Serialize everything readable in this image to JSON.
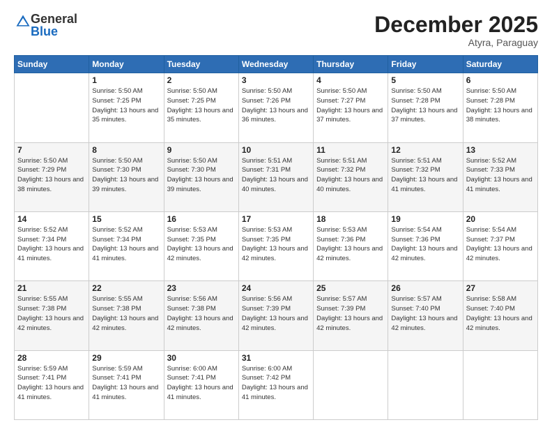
{
  "header": {
    "logo_general": "General",
    "logo_blue": "Blue",
    "month_title": "December 2025",
    "location": "Atyra, Paraguay"
  },
  "calendar": {
    "days_of_week": [
      "Sunday",
      "Monday",
      "Tuesday",
      "Wednesday",
      "Thursday",
      "Friday",
      "Saturday"
    ],
    "weeks": [
      [
        {
          "day": "",
          "info": ""
        },
        {
          "day": "1",
          "info": "Sunrise: 5:50 AM\nSunset: 7:25 PM\nDaylight: 13 hours\nand 35 minutes."
        },
        {
          "day": "2",
          "info": "Sunrise: 5:50 AM\nSunset: 7:25 PM\nDaylight: 13 hours\nand 35 minutes."
        },
        {
          "day": "3",
          "info": "Sunrise: 5:50 AM\nSunset: 7:26 PM\nDaylight: 13 hours\nand 36 minutes."
        },
        {
          "day": "4",
          "info": "Sunrise: 5:50 AM\nSunset: 7:27 PM\nDaylight: 13 hours\nand 37 minutes."
        },
        {
          "day": "5",
          "info": "Sunrise: 5:50 AM\nSunset: 7:28 PM\nDaylight: 13 hours\nand 37 minutes."
        },
        {
          "day": "6",
          "info": "Sunrise: 5:50 AM\nSunset: 7:28 PM\nDaylight: 13 hours\nand 38 minutes."
        }
      ],
      [
        {
          "day": "7",
          "info": "Sunrise: 5:50 AM\nSunset: 7:29 PM\nDaylight: 13 hours\nand 38 minutes."
        },
        {
          "day": "8",
          "info": "Sunrise: 5:50 AM\nSunset: 7:30 PM\nDaylight: 13 hours\nand 39 minutes."
        },
        {
          "day": "9",
          "info": "Sunrise: 5:50 AM\nSunset: 7:30 PM\nDaylight: 13 hours\nand 39 minutes."
        },
        {
          "day": "10",
          "info": "Sunrise: 5:51 AM\nSunset: 7:31 PM\nDaylight: 13 hours\nand 40 minutes."
        },
        {
          "day": "11",
          "info": "Sunrise: 5:51 AM\nSunset: 7:32 PM\nDaylight: 13 hours\nand 40 minutes."
        },
        {
          "day": "12",
          "info": "Sunrise: 5:51 AM\nSunset: 7:32 PM\nDaylight: 13 hours\nand 41 minutes."
        },
        {
          "day": "13",
          "info": "Sunrise: 5:52 AM\nSunset: 7:33 PM\nDaylight: 13 hours\nand 41 minutes."
        }
      ],
      [
        {
          "day": "14",
          "info": "Sunrise: 5:52 AM\nSunset: 7:34 PM\nDaylight: 13 hours\nand 41 minutes."
        },
        {
          "day": "15",
          "info": "Sunrise: 5:52 AM\nSunset: 7:34 PM\nDaylight: 13 hours\nand 41 minutes."
        },
        {
          "day": "16",
          "info": "Sunrise: 5:53 AM\nSunset: 7:35 PM\nDaylight: 13 hours\nand 42 minutes."
        },
        {
          "day": "17",
          "info": "Sunrise: 5:53 AM\nSunset: 7:35 PM\nDaylight: 13 hours\nand 42 minutes."
        },
        {
          "day": "18",
          "info": "Sunrise: 5:53 AM\nSunset: 7:36 PM\nDaylight: 13 hours\nand 42 minutes."
        },
        {
          "day": "19",
          "info": "Sunrise: 5:54 AM\nSunset: 7:36 PM\nDaylight: 13 hours\nand 42 minutes."
        },
        {
          "day": "20",
          "info": "Sunrise: 5:54 AM\nSunset: 7:37 PM\nDaylight: 13 hours\nand 42 minutes."
        }
      ],
      [
        {
          "day": "21",
          "info": "Sunrise: 5:55 AM\nSunset: 7:38 PM\nDaylight: 13 hours\nand 42 minutes."
        },
        {
          "day": "22",
          "info": "Sunrise: 5:55 AM\nSunset: 7:38 PM\nDaylight: 13 hours\nand 42 minutes."
        },
        {
          "day": "23",
          "info": "Sunrise: 5:56 AM\nSunset: 7:38 PM\nDaylight: 13 hours\nand 42 minutes."
        },
        {
          "day": "24",
          "info": "Sunrise: 5:56 AM\nSunset: 7:39 PM\nDaylight: 13 hours\nand 42 minutes."
        },
        {
          "day": "25",
          "info": "Sunrise: 5:57 AM\nSunset: 7:39 PM\nDaylight: 13 hours\nand 42 minutes."
        },
        {
          "day": "26",
          "info": "Sunrise: 5:57 AM\nSunset: 7:40 PM\nDaylight: 13 hours\nand 42 minutes."
        },
        {
          "day": "27",
          "info": "Sunrise: 5:58 AM\nSunset: 7:40 PM\nDaylight: 13 hours\nand 42 minutes."
        }
      ],
      [
        {
          "day": "28",
          "info": "Sunrise: 5:59 AM\nSunset: 7:41 PM\nDaylight: 13 hours\nand 41 minutes."
        },
        {
          "day": "29",
          "info": "Sunrise: 5:59 AM\nSunset: 7:41 PM\nDaylight: 13 hours\nand 41 minutes."
        },
        {
          "day": "30",
          "info": "Sunrise: 6:00 AM\nSunset: 7:41 PM\nDaylight: 13 hours\nand 41 minutes."
        },
        {
          "day": "31",
          "info": "Sunrise: 6:00 AM\nSunset: 7:42 PM\nDaylight: 13 hours\nand 41 minutes."
        },
        {
          "day": "",
          "info": ""
        },
        {
          "day": "",
          "info": ""
        },
        {
          "day": "",
          "info": ""
        }
      ]
    ]
  }
}
